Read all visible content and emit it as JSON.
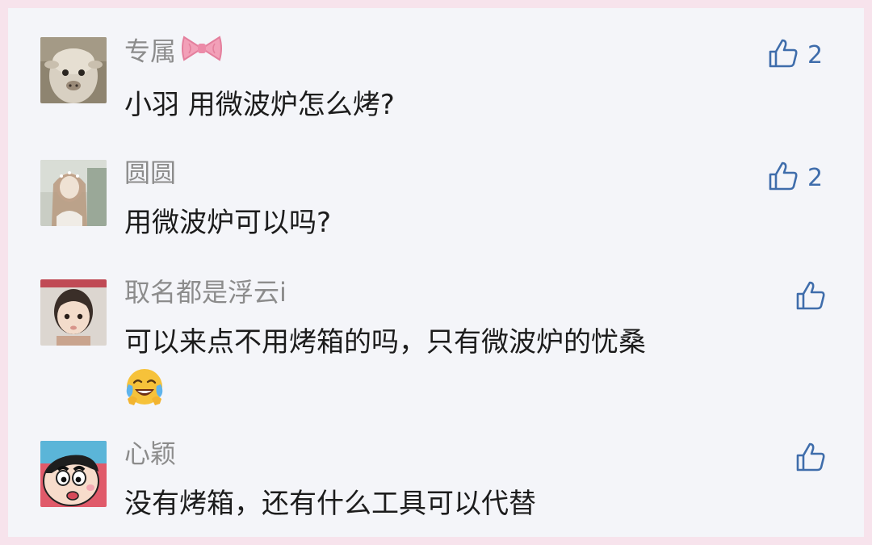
{
  "comments": [
    {
      "username": "专属",
      "username_emoji": "bow-icon",
      "text": "小羽 用微波炉怎么烤?",
      "likes": "2",
      "avatar": "sheep-avatar"
    },
    {
      "username": "圆圆",
      "text": "用微波炉可以吗?",
      "likes": "2",
      "avatar": "girl-avatar"
    },
    {
      "username": "取名都是浮云i",
      "text": "可以来点不用烤箱的吗，只有微波炉的忧桑",
      "text_emoji": "laughing-crying-emoji",
      "likes": "",
      "avatar": "child-avatar"
    },
    {
      "username": "心颖",
      "text": "没有烤箱，还有什么工具可以代替",
      "likes": "",
      "avatar": "cartoon-avatar"
    }
  ],
  "colors": {
    "border": "#f7e3ec",
    "panel": "#f4f5f9",
    "username": "#8c8c8c",
    "text": "#1c1c1c",
    "like": "#3f6dab"
  }
}
